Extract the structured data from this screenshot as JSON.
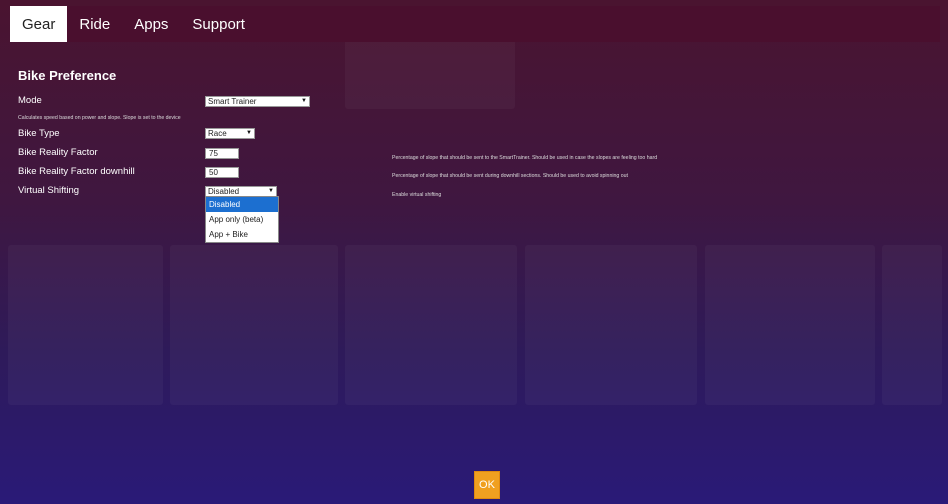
{
  "tabs": [
    {
      "label": "Gear",
      "active": true
    },
    {
      "label": "Ride",
      "active": false
    },
    {
      "label": "Apps",
      "active": false
    },
    {
      "label": "Support",
      "active": false
    }
  ],
  "bike_preference": {
    "title": "Bike Preference",
    "mode": {
      "label": "Mode",
      "value": "Smart Trainer",
      "note": "Calculates speed based on power and slope. Slope is set to the device"
    },
    "bike_type": {
      "label": "Bike Type",
      "value": "Race"
    },
    "reality_factor": {
      "label": "Bike Reality Factor",
      "value": "75",
      "note": "Percentage of slope that should be sent to the SmartTrainer. Should be used in case the slopes are feeling too hard"
    },
    "reality_factor_downhill": {
      "label": "Bike Reality Factor downhill",
      "value": "50",
      "note": "Percentage of slope that should be sent during downhill sections. Should be used to avoid spinning out"
    },
    "virtual_shifting": {
      "label": "Virtual Shifting",
      "value": "Disabled",
      "note": "Enable virtual shifting",
      "options": [
        "Disabled",
        "App only (beta)",
        "App + Bike"
      ],
      "selected_index": 0
    }
  },
  "ok_label": "OK",
  "colors": {
    "tabbar": "#4a0f2e",
    "ok_button": "#f0a020",
    "dropdown_highlight": "#1c6fd0"
  }
}
